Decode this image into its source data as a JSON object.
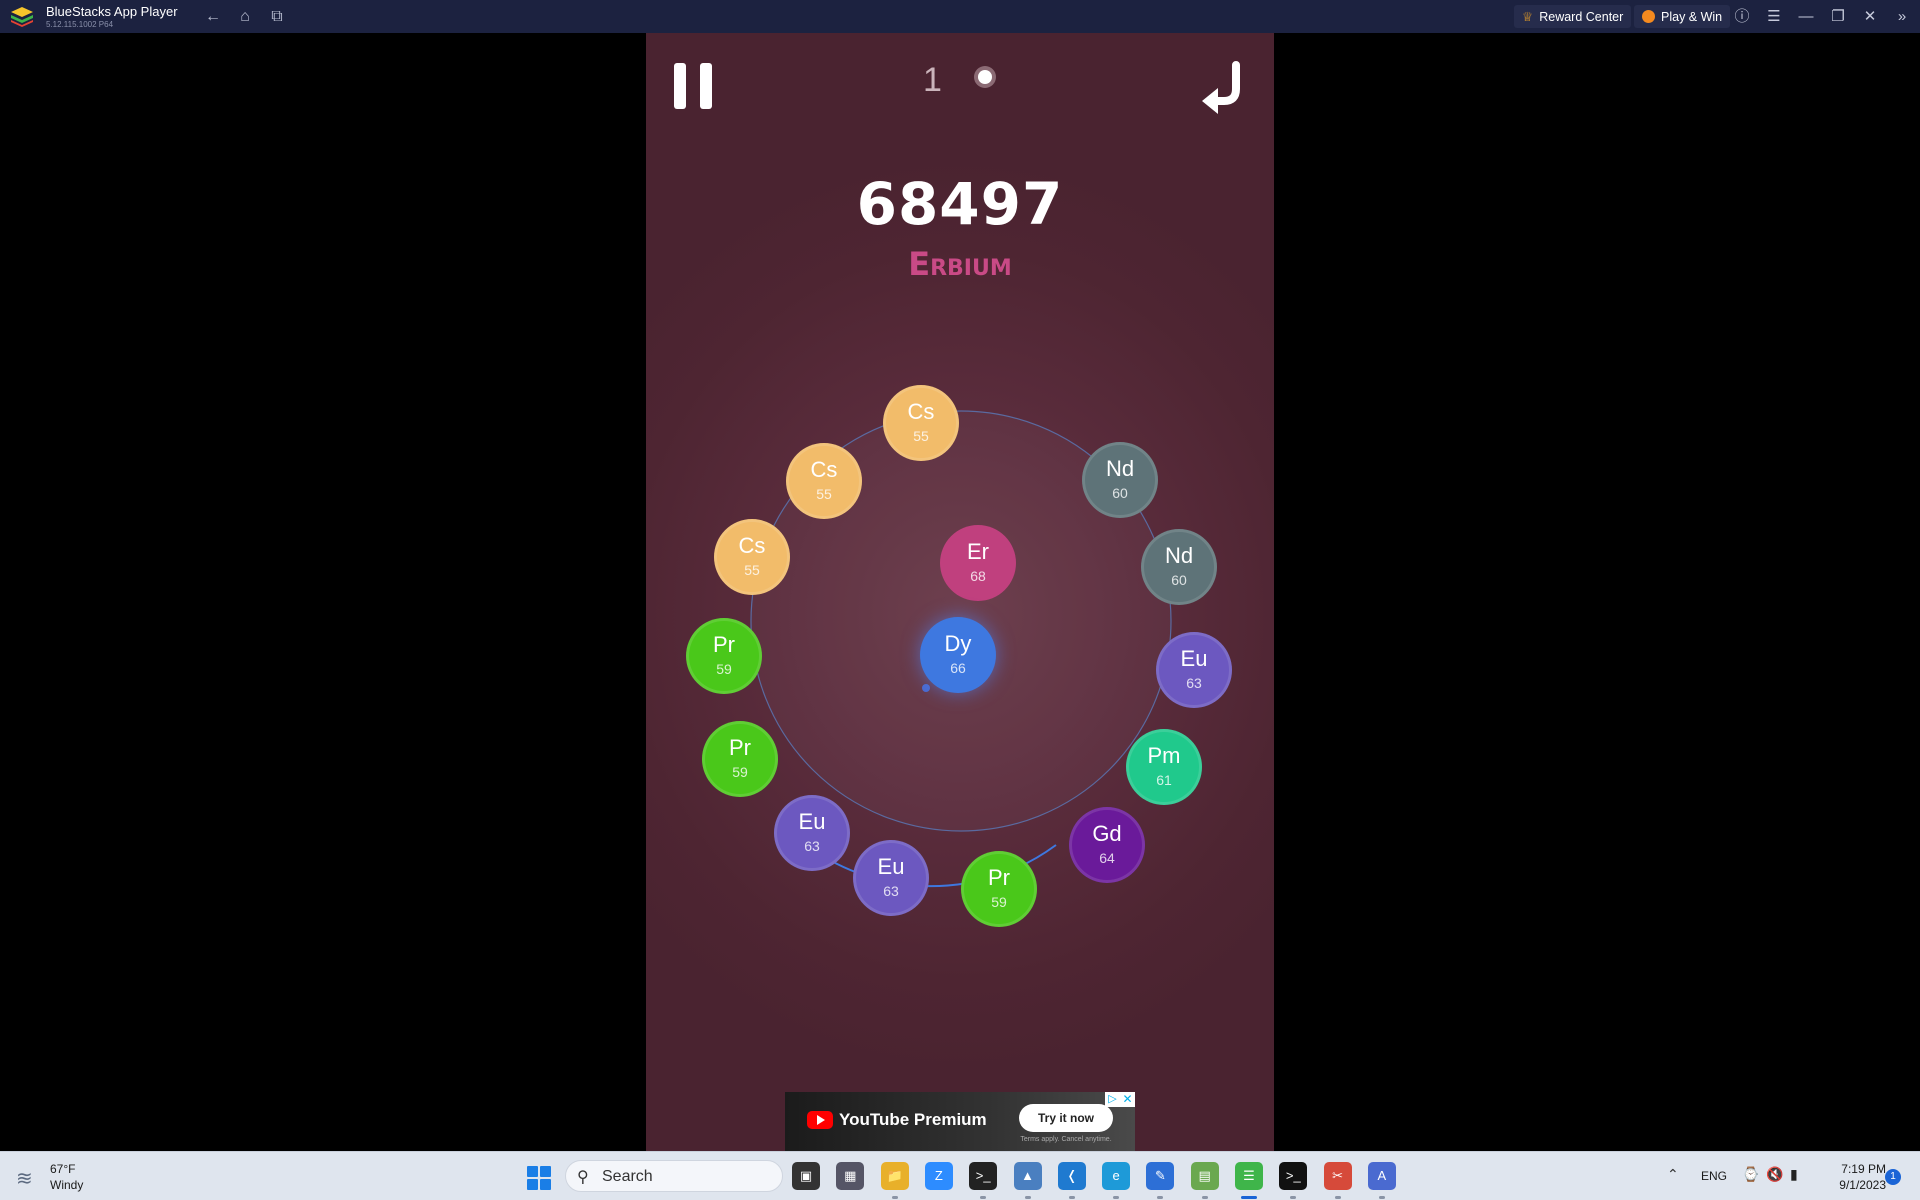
{
  "titlebar": {
    "app_title": "BlueStacks App Player",
    "version": "5.12.115.1002  P64",
    "nav_icons": [
      "back-icon",
      "home-icon",
      "multi-instance-icon"
    ],
    "reward_center": "Reward Center",
    "play_win": "Play & Win",
    "controls": [
      "help-icon",
      "menu-icon",
      "minimize-icon",
      "restore-icon",
      "close-icon",
      "collapse-sidebar-icon"
    ]
  },
  "game": {
    "counter": "1",
    "score": "68497",
    "element_name": "Erbium",
    "center_atom": {
      "symbol": "Er",
      "number": "68",
      "color": "#c0407e"
    },
    "next_atom": {
      "symbol": "Dy",
      "number": "66",
      "color": "#3e78e0"
    },
    "ring_atoms": [
      {
        "symbol": "Cs",
        "number": "55",
        "color": "#f2bc6a"
      },
      {
        "symbol": "Nd",
        "number": "60",
        "color": "#5e7378"
      },
      {
        "symbol": "Nd",
        "number": "60",
        "color": "#5e7378"
      },
      {
        "symbol": "Eu",
        "number": "63",
        "color": "#6c58c0"
      },
      {
        "symbol": "Pm",
        "number": "61",
        "color": "#20c98c"
      },
      {
        "symbol": "Gd",
        "number": "64",
        "color": "#6a1a9a"
      },
      {
        "symbol": "Pr",
        "number": "59",
        "color": "#4ac81a"
      },
      {
        "symbol": "Eu",
        "number": "63",
        "color": "#6c58c0"
      },
      {
        "symbol": "Eu",
        "number": "63",
        "color": "#6c58c0"
      },
      {
        "symbol": "Pr",
        "number": "59",
        "color": "#4ac81a"
      },
      {
        "symbol": "Pr",
        "number": "59",
        "color": "#4ac81a"
      },
      {
        "symbol": "Cs",
        "number": "55",
        "color": "#f2bc6a"
      },
      {
        "symbol": "Cs",
        "number": "55",
        "color": "#f2bc6a"
      }
    ],
    "ad": {
      "brand": "YouTube Premium",
      "cta": "Try it now",
      "terms": "Terms apply. Cancel anytime."
    }
  },
  "taskbar": {
    "weather_temp": "67°F",
    "weather_cond": "Windy",
    "search_placeholder": "Search",
    "apps": [
      "task-view-icon",
      "app-icon",
      "file-explorer-icon",
      "zoom-icon",
      "terminal-icon",
      "photos-icon",
      "vscode-icon",
      "edge-icon",
      "paint-icon",
      "chart-app-icon",
      "bluestacks-icon",
      "cmd-icon",
      "snipping-tool-icon",
      "app-icon"
    ],
    "lang": "ENG",
    "time": "7:19 PM",
    "date": "9/1/2023",
    "notification_count": "1"
  }
}
